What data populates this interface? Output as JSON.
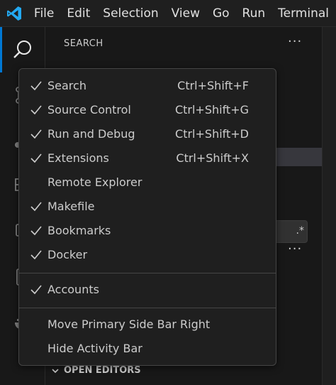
{
  "menubar": {
    "items": [
      "File",
      "Edit",
      "Selection",
      "View",
      "Go",
      "Run",
      "Terminal"
    ]
  },
  "activitybar": {
    "icons": [
      "search-icon",
      "source-control-icon",
      "run-debug-icon",
      "extensions-icon",
      "remote-explorer-icon",
      "makefile-icon",
      "docker-icon"
    ]
  },
  "sidebar": {
    "title": "SEARCH",
    "more": "···",
    "search_options_glyph": ".*",
    "open_editors": "OPEN EDITORS"
  },
  "context_menu": {
    "items": [
      {
        "label": "Search",
        "shortcut": "Ctrl+Shift+F",
        "checked": true
      },
      {
        "label": "Source Control",
        "shortcut": "Ctrl+Shift+G",
        "checked": true
      },
      {
        "label": "Run and Debug",
        "shortcut": "Ctrl+Shift+D",
        "checked": true
      },
      {
        "label": "Extensions",
        "shortcut": "Ctrl+Shift+X",
        "checked": true
      },
      {
        "label": "Remote Explorer",
        "shortcut": "",
        "checked": false
      },
      {
        "label": "Makefile",
        "shortcut": "",
        "checked": true
      },
      {
        "label": "Bookmarks",
        "shortcut": "",
        "checked": true
      },
      {
        "label": "Docker",
        "shortcut": "",
        "checked": true
      }
    ],
    "accounts": {
      "label": "Accounts",
      "checked": true
    },
    "bottom_items": [
      {
        "label": "Move Primary Side Bar Right"
      },
      {
        "label": "Hide Activity Bar"
      }
    ]
  },
  "colors": {
    "accent": "#0078d4",
    "logo": "#23a9f2"
  }
}
